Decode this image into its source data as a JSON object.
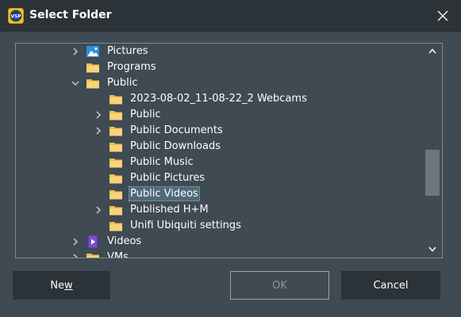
{
  "window": {
    "title": "Select Folder",
    "app_icon_text": "VSP",
    "colors": {
      "titlebar": "#2b3338",
      "background": "#3f4a52",
      "folder": "#f2c14e",
      "selection": "#4f6a7a"
    }
  },
  "tree": {
    "items": [
      {
        "label": "Pictures",
        "icon": "pictures-icon",
        "expander": "collapsed"
      },
      {
        "label": "Programs",
        "icon": "folder-icon",
        "expander": "none"
      },
      {
        "label": "Public",
        "icon": "folder-icon",
        "expander": "expanded"
      },
      {
        "label": "2023-08-02_11-08-22_2 Webcams",
        "icon": "folder-icon",
        "expander": "none"
      },
      {
        "label": "Public",
        "icon": "folder-icon",
        "expander": "collapsed"
      },
      {
        "label": "Public Documents",
        "icon": "folder-icon",
        "expander": "collapsed"
      },
      {
        "label": "Public Downloads",
        "icon": "folder-icon",
        "expander": "none"
      },
      {
        "label": "Public Music",
        "icon": "folder-icon",
        "expander": "none"
      },
      {
        "label": "Public Pictures",
        "icon": "folder-icon",
        "expander": "none"
      },
      {
        "label": "Public Videos",
        "icon": "folder-icon",
        "expander": "none",
        "selected": true
      },
      {
        "label": "Published H+M",
        "icon": "folder-icon",
        "expander": "collapsed"
      },
      {
        "label": "Unifi Ubiquiti settings",
        "icon": "folder-icon",
        "expander": "none"
      },
      {
        "label": "Videos",
        "icon": "videos-icon",
        "expander": "collapsed"
      },
      {
        "label": "VMs",
        "icon": "folder-icon",
        "expander": "collapsed"
      }
    ]
  },
  "buttons": {
    "new_prefix": "Ne",
    "new_accel": "w",
    "ok": "OK",
    "cancel": "Cancel"
  }
}
